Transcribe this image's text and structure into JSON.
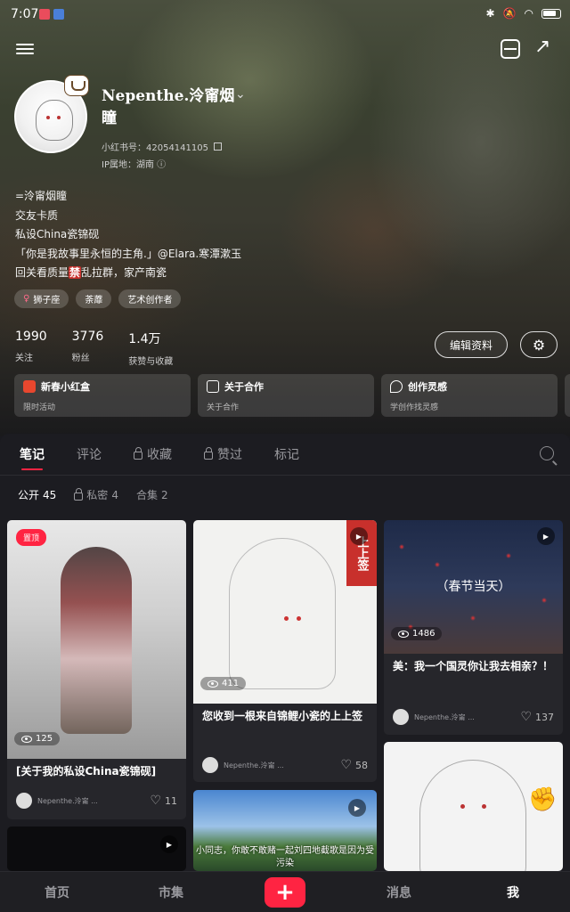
{
  "status_bar": {
    "time": "7:07",
    "app_icon_colors": [
      "#ea4c5c",
      "#4a7fd8"
    ]
  },
  "profile": {
    "nickname": "Nepenthe.泠甯烟瞳",
    "rednote_id": "小红书号：42054141105",
    "ip_location": "IP属地：湖南 ⓘ",
    "bio": [
      "=泠甯烟瞳",
      "交友卡质",
      "私设China瓷锦砚",
      "「你是我故事里永恒的主角.」@Elara.寒潭漱玉",
      {
        "pre": "回关看质量",
        "hl": "禁",
        "post": "乱拉群，家产南瓷"
      }
    ],
    "tags": [
      {
        "icon": "female-icon",
        "label": "狮子座"
      },
      {
        "icon": "",
        "label": "荼蘼"
      },
      {
        "icon": "",
        "label": "艺术创作者"
      }
    ],
    "stats": [
      {
        "value": "1990",
        "label": "关注"
      },
      {
        "value": "3776",
        "label": "粉丝"
      },
      {
        "value": "1.4万",
        "label": "获赞与收藏"
      }
    ],
    "edit_label": "编辑资料"
  },
  "shortcut_cards": [
    {
      "title": "新春小红盒",
      "subtitle": "限时活动",
      "icon": "gift-icon",
      "color": "#e8472e"
    },
    {
      "title": "关于合作",
      "subtitle": "关于合作",
      "icon": "cooperation-icon",
      "color": "#ffffff"
    },
    {
      "title": "创作灵感",
      "subtitle": "学创作找灵感",
      "icon": "location-icon",
      "color": "#ffffff"
    }
  ],
  "tabs": [
    "笔记",
    "评论",
    "收藏",
    "赞过",
    "标记"
  ],
  "subtabs": [
    {
      "label": "公开",
      "count": "45"
    },
    {
      "label": "私密",
      "count": "4"
    },
    {
      "label": "合集",
      "count": "2"
    }
  ],
  "notes": [
    {
      "pin": "置顶",
      "views": "125",
      "title": "[关于我的私设China瓷锦砚]",
      "author": "Nepenthe.泠甯 ...",
      "likes": "11"
    },
    {
      "views": "411",
      "title": "您收到一根来自锦鲤小瓷的上上签",
      "author": "Nepenthe.泠甯 ...",
      "likes": "58",
      "badge_text": "上上签"
    },
    {
      "views": "1486",
      "title": "美：我一个国灵你让我去相亲？！",
      "author": "Nepenthe.泠甯 ...",
      "likes": "137",
      "img_text": "（春节当天）"
    },
    {
      "subtitle_text": "小同志，你敢不敢赌一起刘四地截歌是因为受污染"
    },
    {},
    {}
  ],
  "bottom_nav": [
    "首页",
    "市集",
    "+",
    "消息",
    "我"
  ],
  "accent": "#ff2442"
}
